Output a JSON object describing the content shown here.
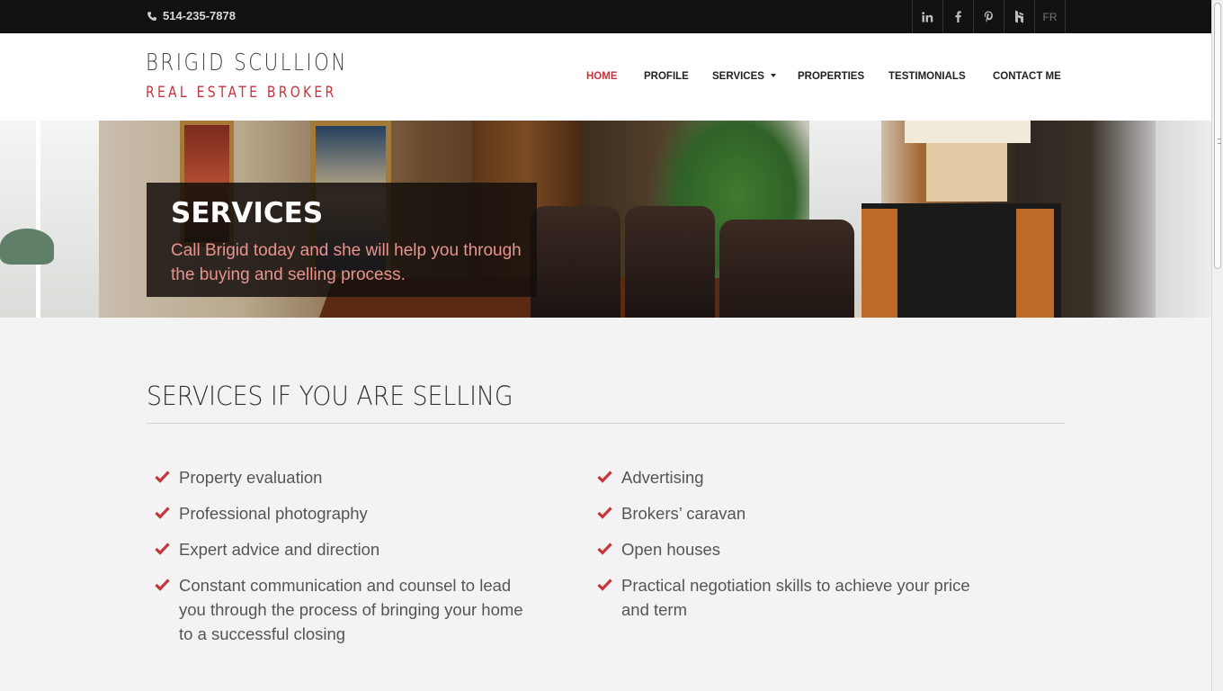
{
  "topbar": {
    "phone": "514-235-7878",
    "icons": [
      "phone-icon",
      "linkedin-icon",
      "facebook-icon",
      "pinterest-icon",
      "houzz-icon"
    ],
    "social": [
      {
        "name": "linkedin-icon",
        "label": "in"
      },
      {
        "name": "facebook-icon",
        "label": "f"
      },
      {
        "name": "pinterest-icon",
        "label": "p"
      },
      {
        "name": "houzz-icon",
        "label": "h"
      }
    ],
    "lang": "FR"
  },
  "header": {
    "brand_name": "BRIGID SCULLION",
    "brand_sub": "REAL ESTATE BROKER"
  },
  "nav": {
    "home": "HOME",
    "profile": "PROFILE",
    "services": "SERVICES",
    "properties": "PROPERTIES",
    "testimonials": "TESTIMONIALS",
    "contact": "CONTACT ME",
    "active": "HOME"
  },
  "hero": {
    "title": "SERVICES",
    "text": "Call Brigid today and she will help you through the buying and selling process."
  },
  "section": {
    "title": "SERVICES IF YOU ARE SELLING",
    "left_items": [
      "Property evaluation",
      "Professional photography",
      "Expert advice and direction",
      "Constant communication and counsel to lead you through the process of bringing your home to a successful closing"
    ],
    "right_items": [
      "Advertising",
      "Brokers’ caravan",
      "Open houses",
      "Practical negotiation skills to achieve your price and term"
    ]
  },
  "colors": {
    "accent": "#c8343e",
    "topbar": "#111111",
    "text": "#555555"
  }
}
